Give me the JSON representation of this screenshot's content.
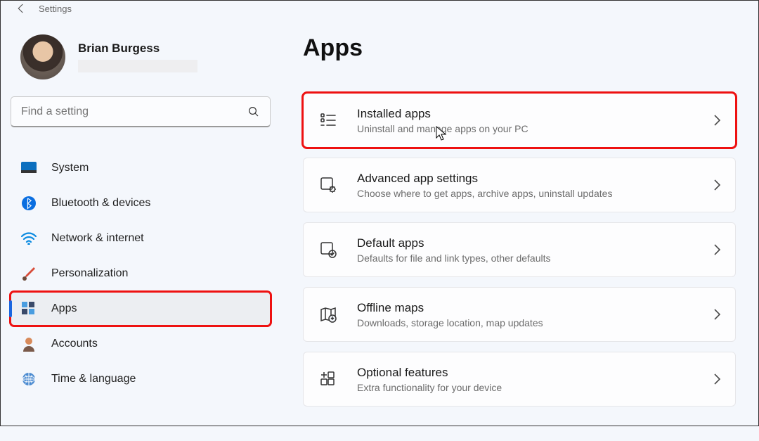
{
  "topbar": {
    "title": "Settings"
  },
  "user": {
    "name": "Brian Burgess"
  },
  "search": {
    "placeholder": "Find a setting"
  },
  "sidebar": {
    "items": [
      {
        "id": "system",
        "label": "System",
        "icon": "system-icon"
      },
      {
        "id": "bluetooth",
        "label": "Bluetooth & devices",
        "icon": "bluetooth-icon"
      },
      {
        "id": "network",
        "label": "Network & internet",
        "icon": "wifi-icon"
      },
      {
        "id": "personalization",
        "label": "Personalization",
        "icon": "brush-icon"
      },
      {
        "id": "apps",
        "label": "Apps",
        "icon": "apps-icon"
      },
      {
        "id": "accounts",
        "label": "Accounts",
        "icon": "person-icon"
      },
      {
        "id": "time",
        "label": "Time & language",
        "icon": "globe-icon"
      }
    ],
    "active": "apps",
    "highlighted": "apps"
  },
  "main": {
    "title": "Apps",
    "highlighted": "installed",
    "cards": [
      {
        "id": "installed",
        "title": "Installed apps",
        "desc": "Uninstall and manage apps on your PC",
        "icon": "list-icon"
      },
      {
        "id": "advanced",
        "title": "Advanced app settings",
        "desc": "Choose where to get apps, archive apps, uninstall updates",
        "icon": "gear-app-icon"
      },
      {
        "id": "default",
        "title": "Default apps",
        "desc": "Defaults for file and link types, other defaults",
        "icon": "default-app-icon"
      },
      {
        "id": "offline",
        "title": "Offline maps",
        "desc": "Downloads, storage location, map updates",
        "icon": "map-icon"
      },
      {
        "id": "optional",
        "title": "Optional features",
        "desc": "Extra functionality for your device",
        "icon": "optional-icon"
      }
    ]
  }
}
